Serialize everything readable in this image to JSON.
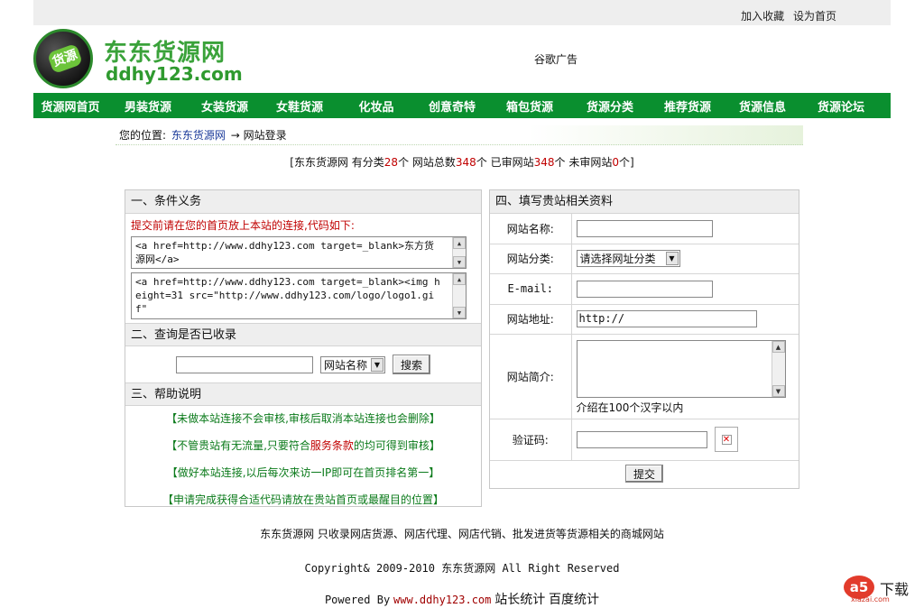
{
  "top_links": [
    "加入收藏",
    "设为首页"
  ],
  "logo": {
    "badge": "货源",
    "name": "东东货源网",
    "url": "ddhy123.com"
  },
  "ad_text": "谷歌广告",
  "nav": [
    "货源网首页",
    "男装货源",
    "女装货源",
    "女鞋货源",
    "化妆品",
    "创意奇特",
    "箱包货源",
    "货源分类",
    "推荐货源",
    "货源信息",
    "货源论坛"
  ],
  "breadcrumb": {
    "prefix": "您的位置:",
    "site": "东东货源网",
    "arrow": "→",
    "current": "网站登录"
  },
  "stats": {
    "open": "[东东货源网 有分类",
    "categories": "28",
    "t1": "个 网站总数",
    "total": "348",
    "t2": "个 已审网站",
    "approved": "348",
    "t3": "个 未审网站",
    "pending": "0",
    "close": "个]"
  },
  "left": {
    "sec1": "一、条件义务",
    "note": "提交前请在您的首页放上本站的连接,代码如下:",
    "code1": "<a href=http://www.ddhy123.com target=_blank>东方货源网</a>",
    "code2": "<a href=http://www.ddhy123.com target=_blank><img height=31 src=\"http://www.ddhy123.com/logo/logo1.gif\"",
    "sec2": "二、查询是否已收录",
    "search_select": "网站名称",
    "search_button": "搜索",
    "sec3": "三、帮助说明",
    "help": [
      {
        "a": "【未做本站连接不会审核,审核后取消本站连接也会删除】"
      },
      {
        "a": "【不管贵站有无流量,只要符合",
        "red": "服务条款",
        "b": "的均可得到审核】"
      },
      {
        "a": "【做好本站连接,以后每次来访一IP即可在首页排名第一】"
      },
      {
        "a": "【申请完成获得合适代码请放在贵站首页或最醒目的位置】"
      }
    ]
  },
  "right": {
    "sec4": "四、填写贵站相关资料",
    "labels": {
      "name": "网站名称:",
      "category": "网站分类:",
      "email": "E-mail:",
      "address": "网站地址:",
      "intro": "网站简介:",
      "captcha": "验证码:"
    },
    "category_select": "请选择网址分类",
    "address_value": "http://",
    "intro_hint": "介绍在100个汉字以内",
    "submit": "提交"
  },
  "footer": {
    "line1": "东东货源网 只收录网店货源、网店代理、网店代销、批发进货等货源相关的商城网站",
    "line2": "Copyright& 2009-2010 东东货源网 All Right Reserved",
    "powered": "Powered By",
    "powered_url": "www.ddhy123.com",
    "stat1": "站长统计",
    "stat2": "百度统计"
  },
  "watermark": {
    "a5": "a5",
    "dl": "下载",
    "small": "xiazai.com"
  }
}
